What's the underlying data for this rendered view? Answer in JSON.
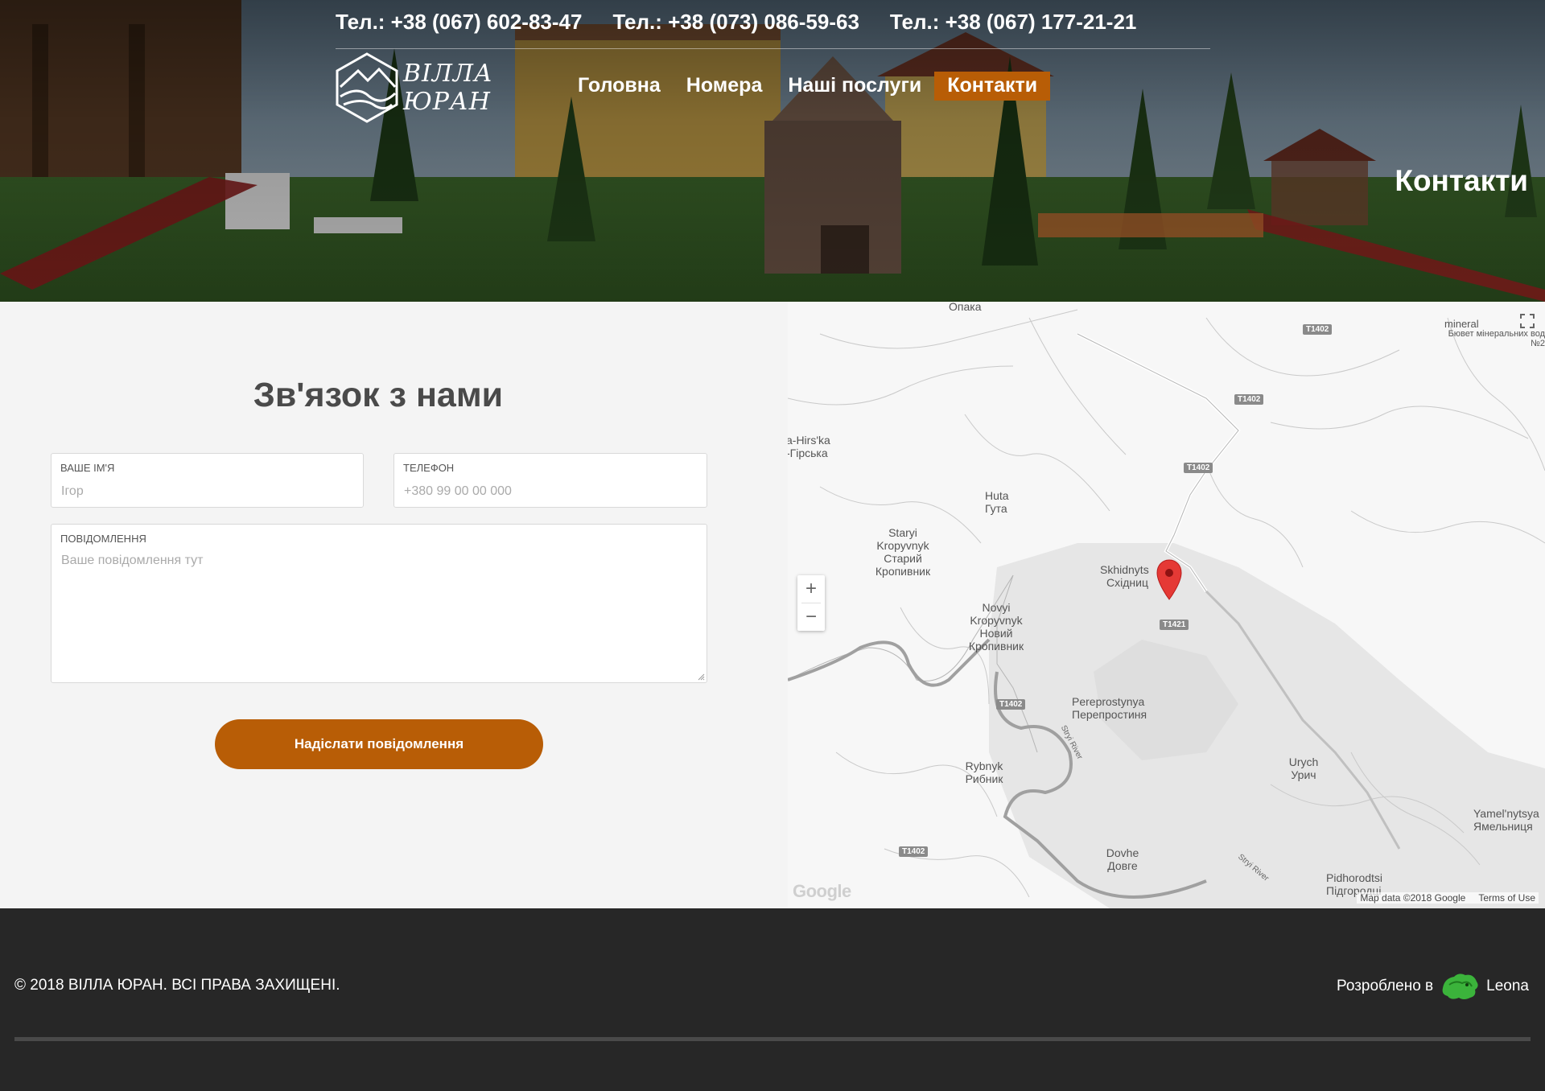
{
  "header": {
    "phones": [
      "Тел.: +38 (067) 602-83-47",
      "Тел.: +38 (073) 086-59-63",
      "Тел.: +38 (067) 177-21-21"
    ],
    "logo": {
      "line1": "ВІЛЛА",
      "line2": "ЮРАН"
    },
    "nav": [
      "Головна",
      "Номера",
      "Наші послуги",
      "Контакти"
    ],
    "active_nav": "Контакти",
    "page_heading": "Контакти"
  },
  "contact": {
    "title": "Зв'язок з нами",
    "name_label": "ВАШЕ ІМ'Я",
    "name_placeholder": "Ігор",
    "phone_label": "ТЕЛЕФОН",
    "phone_placeholder": "+380 99 00 00 000",
    "message_label": "ПОВІДОМЛЕННЯ",
    "message_placeholder": "Ваше повідомлення тут",
    "send_label": "Надіслати повідомлення"
  },
  "map": {
    "places": [
      "Опака",
      "mineral",
      "Бювет мінеральних вод №2",
      "a-Hirs'ka",
      "-Гірська",
      "Huta",
      "Гута",
      "Staryi",
      "Kropyvnyk",
      "Старий",
      "Кропивник",
      "Skhidnyts",
      "Східниц",
      "Novyi",
      "Kropyvnyk",
      "Новий",
      "Кропивник",
      "Pereprostynya",
      "Перепростиня",
      "Rybnyk",
      "Рибник",
      "Urych",
      "Урич",
      "Yamel'nytsya",
      "Ямельниця",
      "Dovhe",
      "Довге",
      "Pidhorodtsi",
      "Підгородці"
    ],
    "roads": [
      "T1402",
      "T1402",
      "T1402",
      "T1421",
      "T1402",
      "T1402"
    ],
    "rivers": [
      "Stryi River",
      "Stryi River"
    ],
    "zoom_in": "+",
    "zoom_out": "−",
    "google": "Google",
    "map_data": "Map data ©2018 Google",
    "terms": "Terms of Use"
  },
  "footer": {
    "copyright": "© 2018 ВІЛЛА ЮРАН. ВСІ ПРАВА ЗАХИЩЕНІ.",
    "developed_by": "Розроблено в",
    "developer": "Leona"
  },
  "colors": {
    "accent": "#b85d06",
    "footer_bg": "#272727",
    "form_bg": "#f4f4f4",
    "pin": "#e53935"
  }
}
